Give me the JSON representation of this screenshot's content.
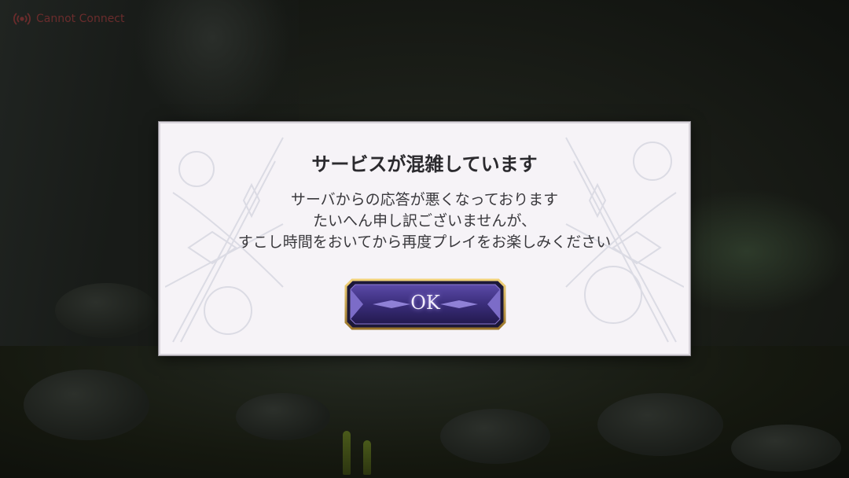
{
  "status": {
    "icon": "signal-broadcast-icon",
    "text": "Cannot Connect",
    "color": "#6a2c2c"
  },
  "dialog": {
    "title": "サービスが混雑しています",
    "message_lines": [
      "サーバからの応答が悪くなっております",
      "たいへん申し訳ございませんが、",
      "すこし時間をおいてから再度プレイをお楽しみください"
    ],
    "ok_label": "OK",
    "colors": {
      "panel": "#f6f3f7",
      "button_fill": "#3a2d7a",
      "button_border": "#c9a24a"
    }
  }
}
